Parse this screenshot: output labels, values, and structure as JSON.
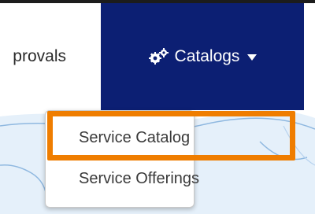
{
  "nav": {
    "approvals_label": "provals",
    "catalogs_label": "Catalogs",
    "catalogs_icon": "gears-icon",
    "catalogs_caret": "caret-down-icon"
  },
  "dropdown": {
    "items": [
      {
        "label": "Service Catalog",
        "highlighted": true
      },
      {
        "label": "Service Offerings",
        "highlighted": false
      }
    ]
  },
  "colors": {
    "nav_active_bg": "#0c1f73",
    "highlight": "#ef7d00",
    "text": "#2a2a2a"
  }
}
